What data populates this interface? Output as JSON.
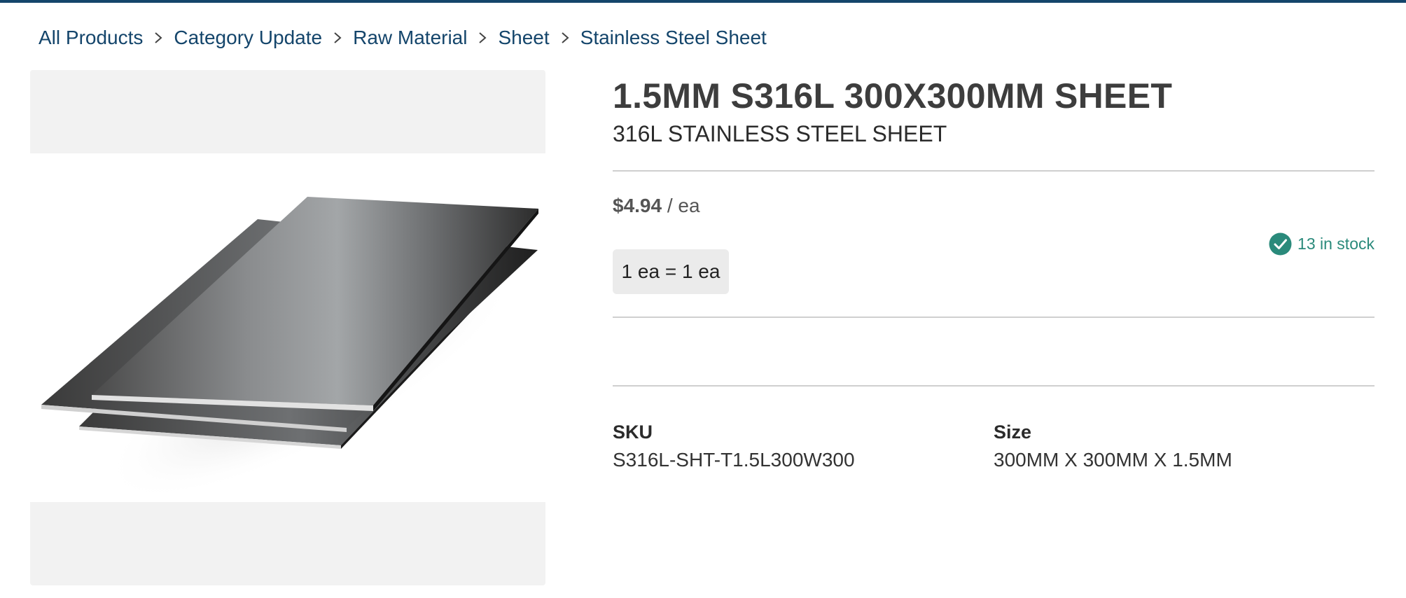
{
  "colors": {
    "brand_navy": "#14456b",
    "stock_teal": "#2a8a7b",
    "chip_bg": "#ebebeb",
    "gallery_band": "#f2f2f2"
  },
  "breadcrumb": {
    "items": [
      {
        "label": "All Products"
      },
      {
        "label": "Category Update"
      },
      {
        "label": "Raw Material"
      },
      {
        "label": "Sheet"
      },
      {
        "label": "Stainless Steel Sheet"
      }
    ],
    "separator_icon": "chevron-right-icon"
  },
  "product": {
    "title": "1.5MM S316L 300X300MM SHEET",
    "subtitle": "316L STAINLESS STEEL SHEET",
    "price": "$4.94",
    "price_unit": "/ ea",
    "uom_conversion": "1 ea = 1 ea",
    "stock": {
      "text": "13 in stock",
      "icon": "check-circle-icon"
    },
    "image_icon": "steel-sheet-product-image"
  },
  "attributes": [
    {
      "label": "SKU",
      "value": "S316L-SHT-T1.5L300W300"
    },
    {
      "label": "Size",
      "value": "300MM X 300MM X 1.5MM"
    }
  ]
}
